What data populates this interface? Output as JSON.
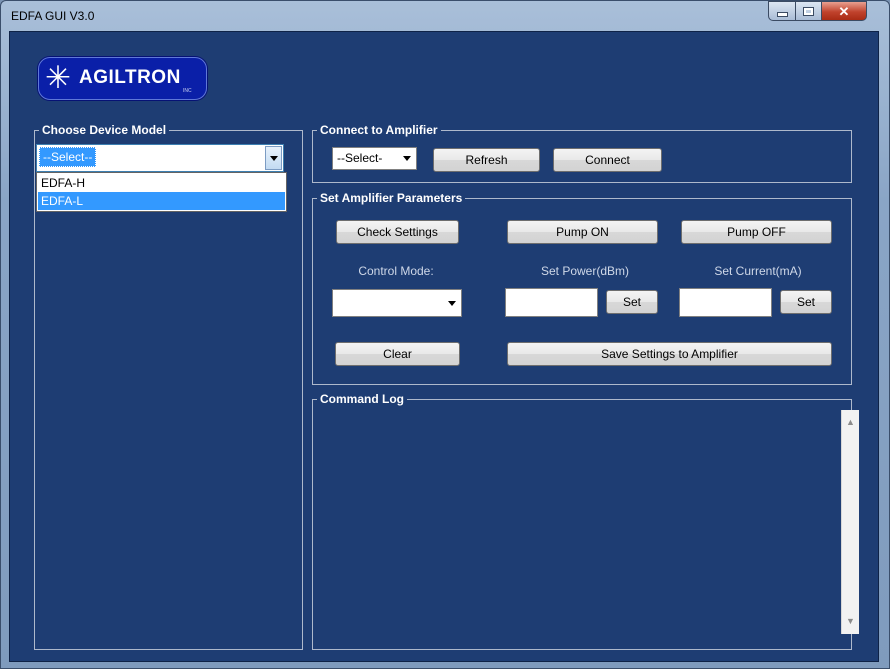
{
  "window": {
    "title": "EDFA GUI V3.0",
    "minimize_glyph": "▬",
    "maximize_glyph": "□",
    "close_glyph": "✕"
  },
  "logo": {
    "text": "AGILTRON",
    "sub": "INC",
    "star_glyph": "✳"
  },
  "device_model": {
    "label": "Choose Device Model",
    "value": "--Select--",
    "options": [
      "EDFA-H",
      "EDFA-L"
    ],
    "highlighted": "EDFA-L"
  },
  "connect": {
    "label": "Connect to Amplifier",
    "port_value": "--Select-",
    "refresh_label": "Refresh",
    "connect_label": "Connect"
  },
  "params": {
    "label": "Set Amplifier Parameters",
    "check_settings": "Check Settings",
    "pump_on": "Pump ON",
    "pump_off": "Pump OFF",
    "control_mode_label": "Control Mode:",
    "control_mode_value": "",
    "set_power_label": "Set Power(dBm)",
    "power_value": "",
    "set_current_label": "Set Current(mA)",
    "current_value": "",
    "set_label": "Set",
    "clear_label": "Clear",
    "save_label": "Save Settings to Amplifier"
  },
  "log": {
    "label": "Command Log",
    "text": ""
  },
  "colors": {
    "panel": "#1e3d73",
    "highlight": "#3399ff",
    "logo": "#0a1fa8"
  },
  "icons": [
    "minimize-icon",
    "maximize-icon",
    "close-icon",
    "dropdown-arrow-icon",
    "scroll-up-icon",
    "scroll-down-icon"
  ]
}
